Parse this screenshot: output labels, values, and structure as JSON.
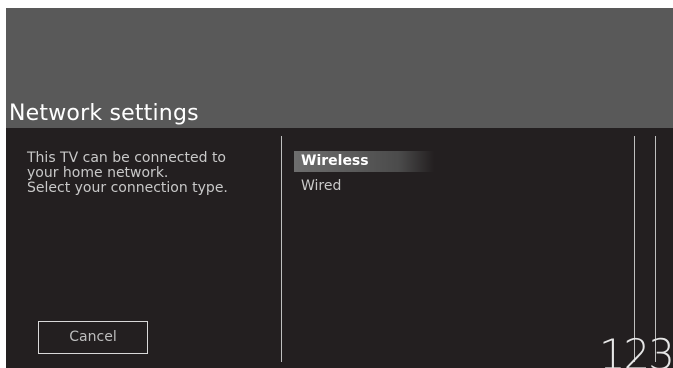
{
  "header": {
    "title": "Network settings"
  },
  "description": {
    "lines": [
      "This TV can be connected to",
      "your home network.",
      "Select your connection type."
    ]
  },
  "options": [
    {
      "label": "Wireless",
      "selected": true
    },
    {
      "label": "Wired",
      "selected": false
    }
  ],
  "buttons": {
    "cancel_label": "Cancel"
  },
  "page_number": "123",
  "colors": {
    "background": "#231f20",
    "header": "#595959",
    "highlight": "#6e6e6e",
    "text": "#c8c8c8"
  }
}
